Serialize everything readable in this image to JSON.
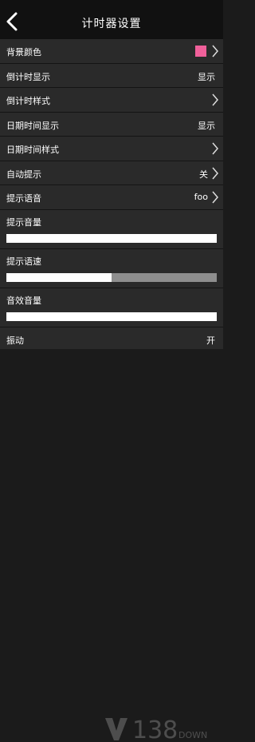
{
  "header": {
    "title": "计时器设置"
  },
  "rows": {
    "bg_color": {
      "label": "背景颜色",
      "color": "#f0609a"
    },
    "countdown_display": {
      "label": "倒计时显示",
      "value": "显示"
    },
    "countdown_style": {
      "label": "倒计时样式"
    },
    "datetime_display": {
      "label": "日期时间显示",
      "value": "显示"
    },
    "datetime_style": {
      "label": "日期时间样式"
    },
    "auto_prompt": {
      "label": "自动提示",
      "value": "关"
    },
    "prompt_voice": {
      "label": "提示语音",
      "value": "foo"
    },
    "prompt_volume": {
      "label": "提示音量",
      "level": 1.0
    },
    "prompt_speed": {
      "label": "提示语速",
      "level": 0.5
    },
    "effect_volume": {
      "label": "音效音量",
      "level": 1.0
    },
    "vibration": {
      "label": "振动",
      "value": "开"
    }
  },
  "watermark": {
    "text": "138",
    "suffix": "DOWN"
  },
  "icons": {
    "back": "back-arrow-icon",
    "chevron": "chevron-right-icon"
  }
}
